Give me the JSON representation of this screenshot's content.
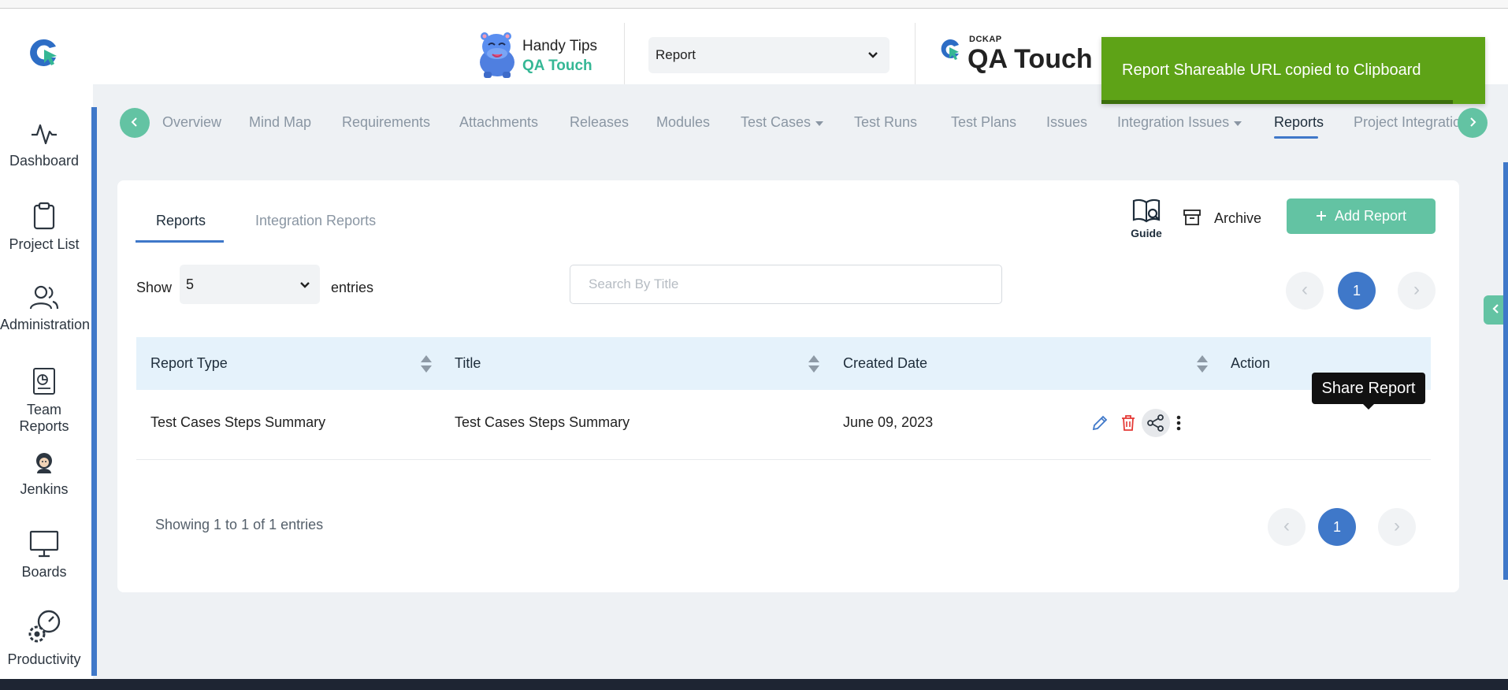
{
  "header": {
    "handy_tips_title": "Handy Tips",
    "handy_tips_sub": "QA Touch",
    "project_select_value": "Report",
    "brand_small": "DCKAP",
    "brand_name": "QA Touch"
  },
  "toast": {
    "message": "Report Shareable URL copied to Clipboard"
  },
  "sidebar": {
    "items": [
      {
        "label": "Dashboard"
      },
      {
        "label": "Project List"
      },
      {
        "label": "Administration"
      },
      {
        "label": "Team Reports"
      },
      {
        "label": "Jenkins"
      },
      {
        "label": "Boards"
      },
      {
        "label": "Productivity"
      }
    ]
  },
  "nav": {
    "tabs": [
      {
        "label": "Overview"
      },
      {
        "label": "Mind Map"
      },
      {
        "label": "Requirements"
      },
      {
        "label": "Attachments"
      },
      {
        "label": "Releases"
      },
      {
        "label": "Modules"
      },
      {
        "label": "Test Cases"
      },
      {
        "label": "Test Runs"
      },
      {
        "label": "Test Plans"
      },
      {
        "label": "Issues"
      },
      {
        "label": "Integration Issues"
      },
      {
        "label": "Reports"
      },
      {
        "label": "Project Integratio"
      }
    ],
    "active": "Reports"
  },
  "reports": {
    "tabs": [
      {
        "label": "Reports"
      },
      {
        "label": "Integration Reports"
      }
    ],
    "guide_label": "Guide",
    "archive_label": "Archive",
    "add_label": "Add Report",
    "show_label": "Show",
    "entries_value": "5",
    "entries_label": "entries",
    "search_placeholder": "Search By Title",
    "page_current": "1",
    "columns": [
      "Report Type",
      "Title",
      "Created Date",
      "Action"
    ],
    "rows": [
      {
        "report_type": "Test Cases Steps Summary",
        "title": "Test Cases Steps Summary",
        "created": "June 09, 2023"
      }
    ],
    "tooltip": "Share Report",
    "showing": "Showing 1 to 1 of 1 entries"
  },
  "colors": {
    "accent_green": "#63c3a3",
    "accent_blue": "#3f78c9",
    "toast_green": "#5ea317",
    "delete_red": "#e53935"
  }
}
